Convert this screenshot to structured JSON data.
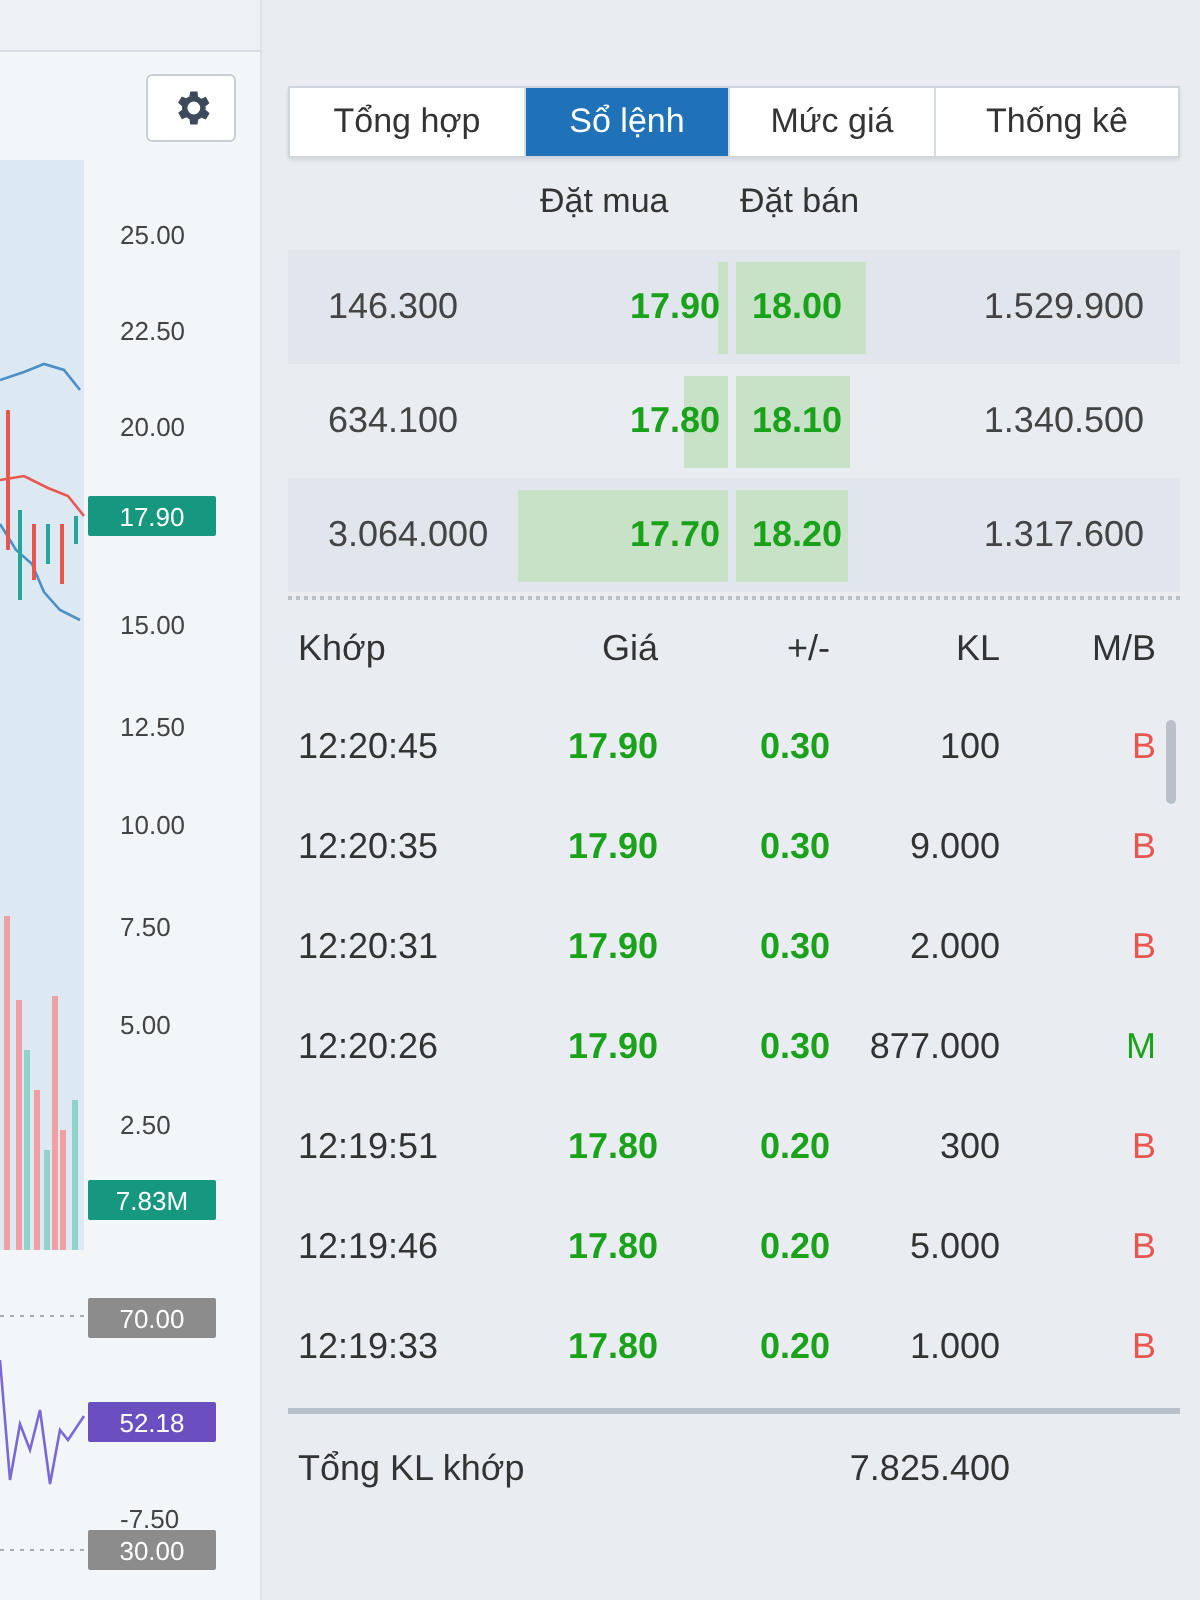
{
  "chart": {
    "price_ticks": [
      "25.00",
      "22.50",
      "20.00",
      "15.00",
      "12.50",
      "10.00",
      "7.50",
      "5.00",
      "2.50"
    ],
    "badges": [
      {
        "text": "17.90",
        "color": "#16977f"
      },
      {
        "text": "7.83M",
        "color": "#16977f"
      },
      {
        "text": "70.00",
        "color": "#8c8c8c"
      },
      {
        "text": "52.18",
        "color": "#6a4fc0"
      },
      {
        "text": "30.00",
        "color": "#8c8c8c"
      }
    ],
    "partial_tick": "-7.50"
  },
  "tabs": [
    {
      "label": "Tổng hợp",
      "selected": false
    },
    {
      "label": "Sổ lệnh",
      "selected": true
    },
    {
      "label": "Mức giá",
      "selected": false
    },
    {
      "label": "Thống kê",
      "selected": false
    }
  ],
  "order_book": {
    "columns": [
      "Đặt mua",
      "Đặt bán"
    ],
    "rows": [
      {
        "bid": {
          "volume": "146.300",
          "price": "17.90"
        },
        "ask": {
          "price": "18.00",
          "volume": "1.529.900"
        }
      },
      {
        "bid": {
          "volume": "634.100",
          "price": "17.80"
        },
        "ask": {
          "price": "18.10",
          "volume": "1.340.500"
        }
      },
      {
        "bid": {
          "volume": "3.064.000",
          "price": "17.70"
        },
        "ask": {
          "price": "18.20",
          "volume": "1.317.600"
        }
      }
    ]
  },
  "trades": {
    "columns": [
      "Khớp",
      "Giá",
      "+/-",
      "KL",
      "M/B"
    ],
    "rows": [
      {
        "time": "12:20:45",
        "price": "17.90",
        "change": "0.30",
        "volume": "100",
        "side": "B",
        "kind": "sell"
      },
      {
        "time": "12:20:35",
        "price": "17.90",
        "change": "0.30",
        "volume": "9.000",
        "side": "B",
        "kind": "sell"
      },
      {
        "time": "12:20:31",
        "price": "17.90",
        "change": "0.30",
        "volume": "2.000",
        "side": "B",
        "kind": "sell"
      },
      {
        "time": "12:20:26",
        "price": "17.90",
        "change": "0.30",
        "volume": "877.000",
        "side": "M",
        "kind": "buy"
      },
      {
        "time": "12:19:51",
        "price": "17.80",
        "change": "0.20",
        "volume": "300",
        "side": "B",
        "kind": "sell"
      },
      {
        "time": "12:19:46",
        "price": "17.80",
        "change": "0.20",
        "volume": "5.000",
        "side": "B",
        "kind": "sell"
      },
      {
        "time": "12:19:33",
        "price": "17.80",
        "change": "0.20",
        "volume": "1.000",
        "side": "B",
        "kind": "sell"
      }
    ],
    "total_label": "Tổng KL khớp",
    "total_value": "7.825.400"
  }
}
